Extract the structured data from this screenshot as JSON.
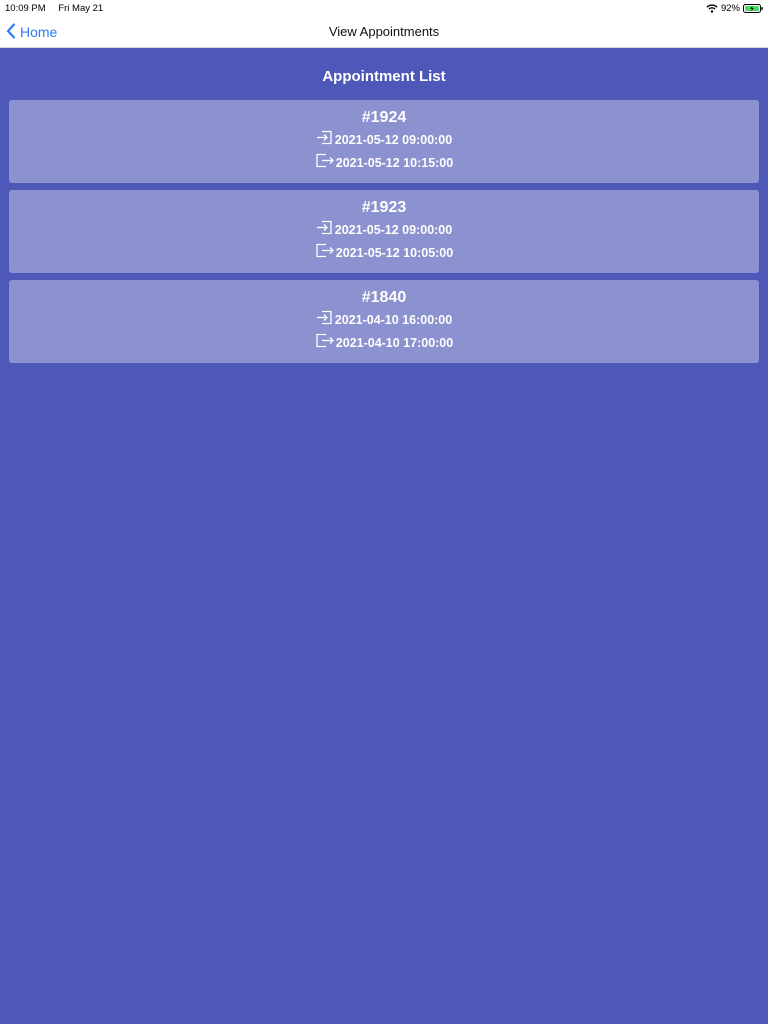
{
  "status": {
    "time": "10:09 PM",
    "date": "Fri May 21",
    "battery": "92%",
    "icons": [
      "wifi-icon",
      "battery-charging-icon"
    ]
  },
  "nav": {
    "back_label": "Home",
    "back_icon": "chevron-left-icon",
    "title": "View Appointments"
  },
  "main": {
    "title": "Appointment List",
    "appointments": [
      {
        "id": "#1924",
        "check_in": "2021-05-12 09:00:00",
        "check_out": "2021-05-12 10:15:00"
      },
      {
        "id": "#1923",
        "check_in": "2021-05-12 09:00:00",
        "check_out": "2021-05-12 10:05:00"
      },
      {
        "id": "#1840",
        "check_in": "2021-04-10 16:00:00",
        "check_out": "2021-04-10 17:00:00"
      }
    ]
  },
  "colors": {
    "background": "#4e58b9",
    "card": "#8c91cf",
    "link": "#2f7cf6",
    "battery": "#4cd964"
  }
}
